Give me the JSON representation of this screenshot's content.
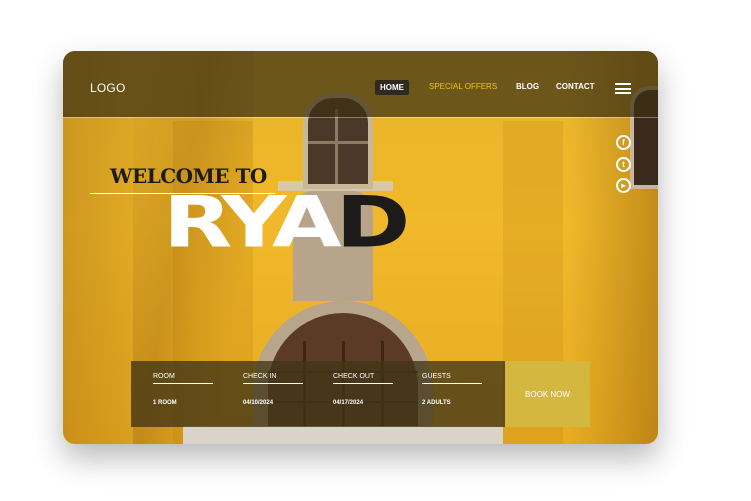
{
  "nav": {
    "logo": "LOGO",
    "items": [
      "HOME",
      "SPECIAL OFFERS",
      "BLOG",
      "CONTACT"
    ],
    "active": "HOME",
    "menu_icon": "hamburger-menu-icon"
  },
  "social": [
    {
      "icon": "facebook-icon",
      "glyph": "f"
    },
    {
      "icon": "twitter-icon",
      "glyph": "t"
    },
    {
      "icon": "youtube-icon",
      "glyph": "▸"
    }
  ],
  "hero": {
    "welcome": "WELCOME TO",
    "title_light": "RYA",
    "title_dark": "D"
  },
  "booking": {
    "fields": [
      {
        "label": "ROOM",
        "value": "1 ROOM"
      },
      {
        "label": "CHECK IN",
        "value": "04/10/2024"
      },
      {
        "label": "CHECK OUT",
        "value": "04/17/2024"
      },
      {
        "label": "GUESTS",
        "value": "2 ADULTS"
      }
    ],
    "cta": "BOOK NOW"
  },
  "colors": {
    "wall_yellow": "#f0b82a",
    "accent_offers": "#f1c40f",
    "book_now": "#d4b73f",
    "overlay": "#3c3012"
  }
}
